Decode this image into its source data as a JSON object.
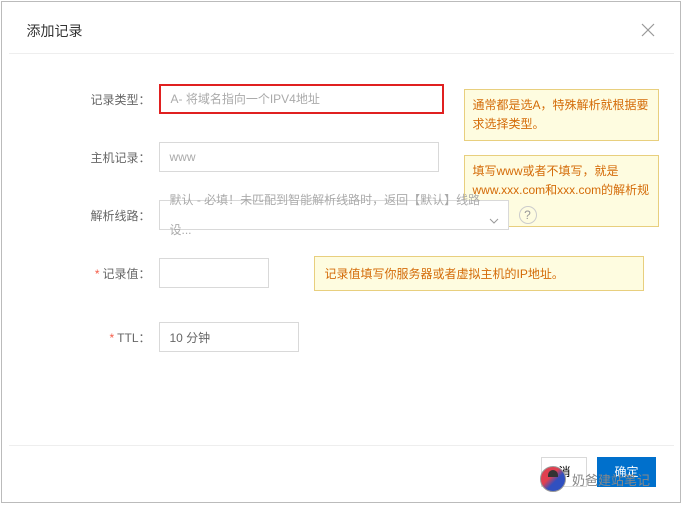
{
  "header": {
    "title": "添加记录"
  },
  "form": {
    "record_type": {
      "label": "记录类型：",
      "value": "A- 将域名指向一个IPV4地址"
    },
    "host": {
      "label": "主机记录：",
      "value": "www"
    },
    "line": {
      "label": "解析线路：",
      "value": "默认 - 必填！未匹配到智能解析线路时，返回【默认】线路设..."
    },
    "record_value": {
      "label": "记录值：",
      "value": ""
    },
    "ttl": {
      "label": "TTL：",
      "value": "10 分钟"
    }
  },
  "notes": {
    "type": "通常都是选A，特殊解析就根据要求选择类型。",
    "host": "填写www或者不填写，就是www.xxx.com和xxx.com的解析规则。",
    "value": "记录值填写你服务器或者虚拟主机的IP地址。"
  },
  "buttons": {
    "cancel": "消",
    "ok": "确定"
  },
  "watermark": "奶爸建站笔记"
}
